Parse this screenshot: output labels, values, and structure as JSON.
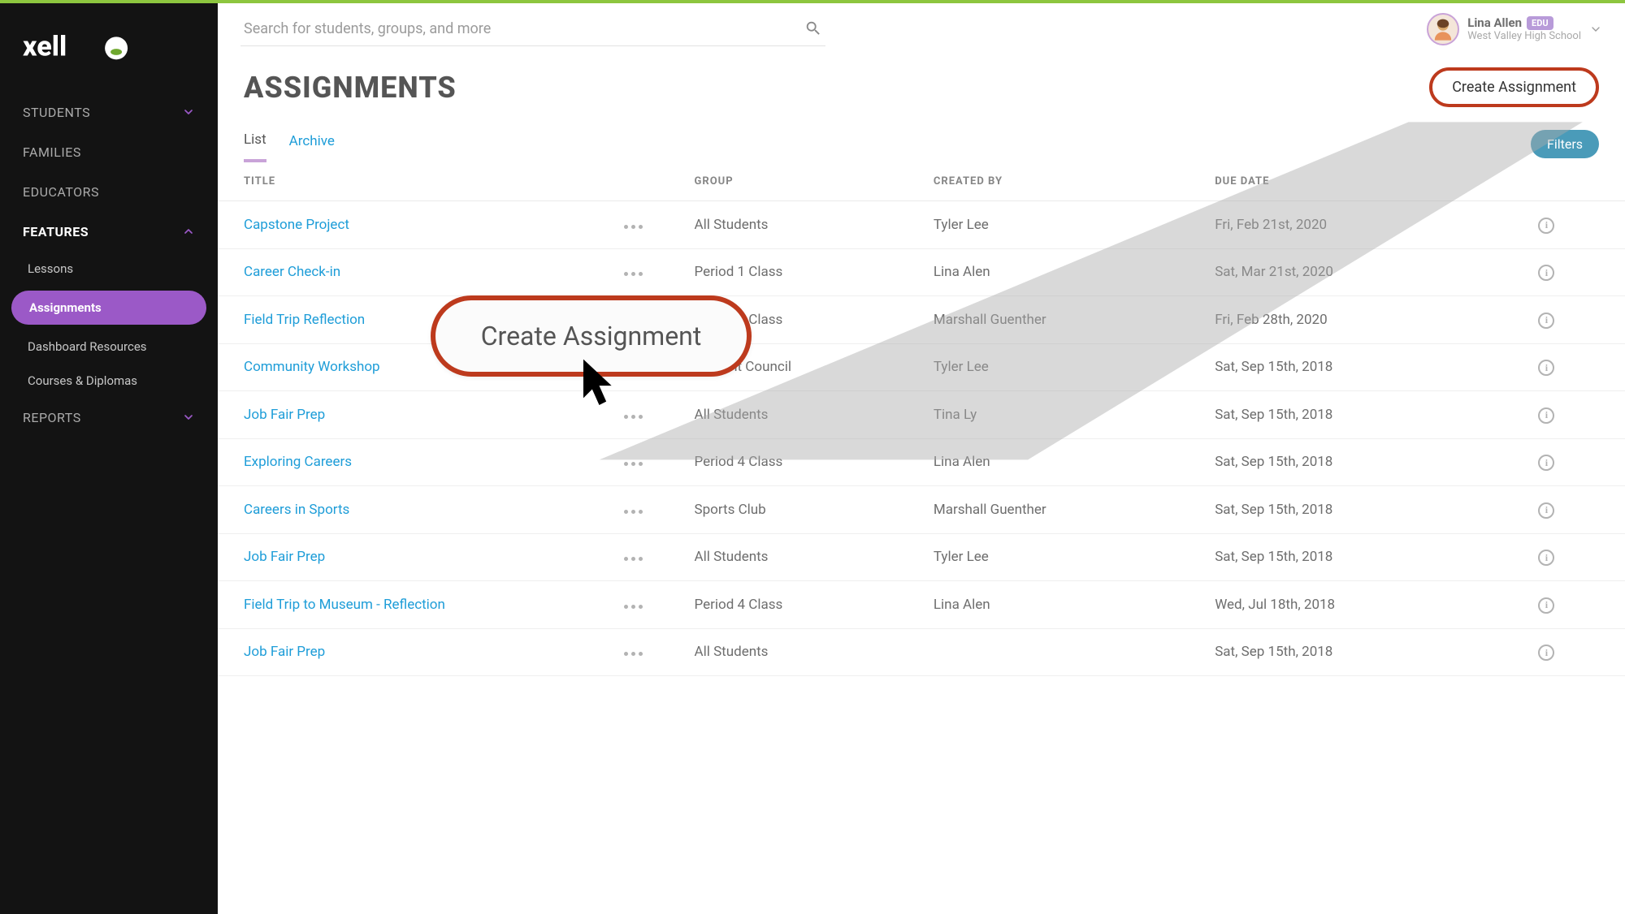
{
  "brand": "xello",
  "search": {
    "placeholder": "Search for students, groups, and more"
  },
  "user": {
    "name": "Lina Allen",
    "badge": "EDU",
    "school": "West Valley High School"
  },
  "sidebar": {
    "items": [
      {
        "label": "STUDENTS",
        "expandable": true,
        "expanded": false
      },
      {
        "label": "FAMILIES",
        "expandable": false
      },
      {
        "label": "EDUCATORS",
        "expandable": false
      },
      {
        "label": "FEATURES",
        "expandable": true,
        "expanded": true
      },
      {
        "label": "REPORTS",
        "expandable": true,
        "expanded": false
      }
    ],
    "features_children": [
      {
        "label": "Lessons",
        "active": false
      },
      {
        "label": "Assignments",
        "active": true
      },
      {
        "label": "Dashboard Resources",
        "active": false
      },
      {
        "label": "Courses & Diplomas",
        "active": false
      }
    ]
  },
  "page": {
    "title": "ASSIGNMENTS",
    "create_label": "Create Assignment",
    "filters_label": "Filters",
    "tabs": {
      "list": "List",
      "archive": "Archive"
    }
  },
  "callout": {
    "zoomed_label": "Create Assignment"
  },
  "table": {
    "headers": {
      "title": "TITLE",
      "group": "GROUP",
      "created_by": "CREATED BY",
      "due_date": "DUE DATE"
    },
    "rows": [
      {
        "title": "Capstone Project",
        "group": "All Students",
        "created_by": "Tyler Lee",
        "due_date": "Fri, Feb 21st, 2020"
      },
      {
        "title": "Career Check-in",
        "group": "Period 1 Class",
        "created_by": "Lina Alen",
        "due_date": "Sat, Mar 21st, 2020"
      },
      {
        "title": "Field Trip Reflection",
        "group": "Period 4 Class",
        "created_by": "Marshall Guenther",
        "due_date": "Fri, Feb 28th, 2020"
      },
      {
        "title": "Community Workshop",
        "group": "Student Council",
        "created_by": "Tyler Lee",
        "due_date": "Sat, Sep 15th, 2018"
      },
      {
        "title": "Job Fair Prep",
        "group": "All Students",
        "created_by": "Tina Ly",
        "due_date": "Sat, Sep 15th, 2018"
      },
      {
        "title": "Exploring Careers",
        "group": "Period 4 Class",
        "created_by": "Lina Alen",
        "due_date": "Sat, Sep 15th, 2018"
      },
      {
        "title": "Careers in Sports",
        "group": "Sports Club",
        "created_by": "Marshall Guenther",
        "due_date": "Sat, Sep 15th, 2018"
      },
      {
        "title": "Job Fair Prep",
        "group": "All Students",
        "created_by": "Tyler Lee",
        "due_date": "Sat, Sep 15th, 2018"
      },
      {
        "title": "Field Trip to Museum - Reflection",
        "group": "Period 4 Class",
        "created_by": "Lina Alen",
        "due_date": "Wed, Jul 18th, 2018"
      },
      {
        "title": "Job Fair Prep",
        "group": "All Students",
        "created_by": "",
        "due_date": "Sat, Sep 15th, 2018"
      }
    ]
  }
}
